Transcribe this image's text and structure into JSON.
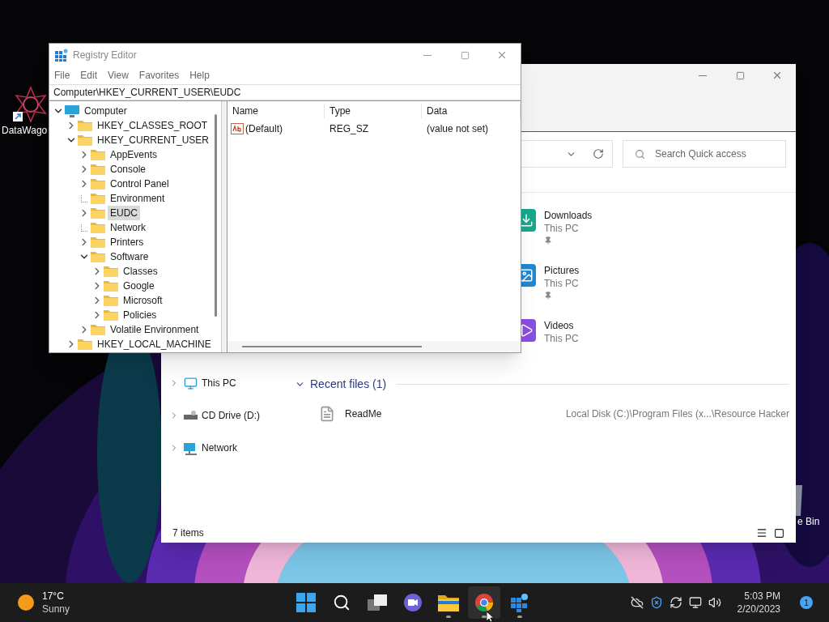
{
  "desktop": {
    "icons": [
      {
        "label": "DataWago",
        "kind": "app"
      },
      {
        "label": "e Bin",
        "kind": "bin"
      }
    ]
  },
  "explorer": {
    "search": {
      "placeholder": "Search Quick access"
    },
    "quick_access": [
      {
        "name": "Downloads",
        "location": "This PC",
        "pinned": true,
        "kind": "downloads"
      },
      {
        "name": "Pictures",
        "location": "This PC",
        "pinned": true,
        "kind": "pictures"
      },
      {
        "name": "Videos",
        "location": "This PC",
        "pinned": false,
        "kind": "videos"
      }
    ],
    "sidebar": [
      {
        "label": "This PC",
        "kind": "pc"
      },
      {
        "label": "CD Drive (D:)",
        "kind": "drive"
      },
      {
        "label": "Network",
        "kind": "network"
      }
    ],
    "recent": {
      "title": "Recent files (1)",
      "expanded": true,
      "files": [
        {
          "name": "ReadMe",
          "path": "Local Disk (C:)\\Program Files (x...\\Resource Hacker"
        }
      ]
    },
    "status_bar": "7 items"
  },
  "registry": {
    "title": "Registry Editor",
    "menu": [
      "File",
      "Edit",
      "View",
      "Favorites",
      "Help"
    ],
    "address": "Computer\\HKEY_CURRENT_USER\\EUDC",
    "tree": [
      {
        "label": "Computer",
        "kind": "computer",
        "expanded": true,
        "selected": false,
        "children": [
          {
            "label": "HKEY_CLASSES_ROOT",
            "kind": "branch",
            "expanded": false,
            "selected": false
          },
          {
            "label": "HKEY_CURRENT_USER",
            "kind": "branch",
            "expanded": true,
            "selected": false,
            "children": [
              {
                "label": "AppEvents",
                "kind": "branch",
                "expanded": false,
                "selected": false
              },
              {
                "label": "Console",
                "kind": "branch",
                "expanded": false,
                "selected": false
              },
              {
                "label": "Control Panel",
                "kind": "branch",
                "expanded": false,
                "selected": false
              },
              {
                "label": "Environment",
                "kind": "leaf",
                "selected": false
              },
              {
                "label": "EUDC",
                "kind": "branch",
                "expanded": false,
                "selected": true
              },
              {
                "label": "Network",
                "kind": "leaf",
                "selected": false
              },
              {
                "label": "Printers",
                "kind": "branch",
                "expanded": false,
                "selected": false
              },
              {
                "label": "Software",
                "kind": "branch",
                "expanded": true,
                "selected": false,
                "children": [
                  {
                    "label": "Classes",
                    "kind": "branch",
                    "expanded": false,
                    "selected": false
                  },
                  {
                    "label": "Google",
                    "kind": "branch",
                    "expanded": false,
                    "selected": false
                  },
                  {
                    "label": "Microsoft",
                    "kind": "branch",
                    "expanded": false,
                    "selected": false
                  },
                  {
                    "label": "Policies",
                    "kind": "branch",
                    "expanded": false,
                    "selected": false
                  }
                ]
              },
              {
                "label": "Volatile Environment",
                "kind": "branch",
                "expanded": false,
                "selected": false
              }
            ]
          },
          {
            "label": "HKEY_LOCAL_MACHINE",
            "kind": "branch",
            "expanded": false,
            "selected": false
          }
        ]
      }
    ],
    "columns": [
      "Name",
      "Type",
      "Data"
    ],
    "values": [
      {
        "name": "(Default)",
        "type": "REG_SZ",
        "data": "(value not set)",
        "kind": "string"
      }
    ]
  },
  "taskbar": {
    "weather": {
      "temperature": "17°C",
      "condition": "Sunny"
    },
    "apps": [
      {
        "kind": "start",
        "running": false,
        "selected": false
      },
      {
        "kind": "search",
        "running": false,
        "selected": false
      },
      {
        "kind": "taskview",
        "running": false,
        "selected": false
      },
      {
        "kind": "chat",
        "running": false,
        "selected": false
      },
      {
        "kind": "explorer",
        "running": true,
        "selected": false
      },
      {
        "kind": "chrome",
        "running": true,
        "selected": true
      },
      {
        "kind": "regedit",
        "running": true,
        "selected": false
      }
    ],
    "time": "5:03 PM",
    "date": "2/20/2023",
    "notifications": "1"
  }
}
